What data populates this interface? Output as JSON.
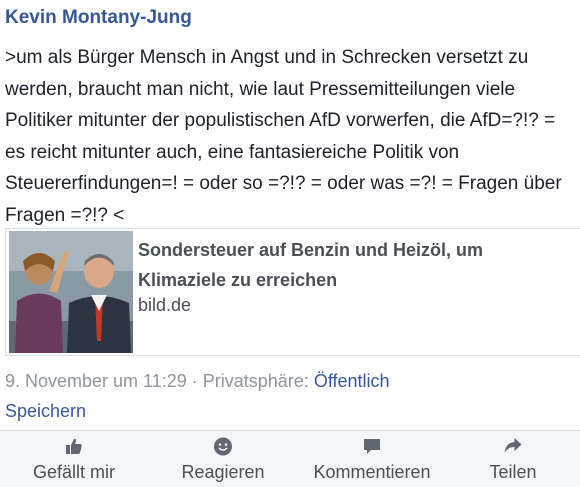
{
  "post": {
    "author": "Kevin Montany-Jung",
    "text": ">um als Bürger Mensch in Angst und in Schrecken versetzt zu werden, braucht man nicht, wie laut Pressemitteilungen viele Politiker mitunter der populistischen AfD vorwerfen, die AfD=?!? = es reicht mitunter auch, eine fantasiereiche Politik von Steuererfindungen=! = oder so =?!? = oder was =?! = Fragen über Fragen =?!? <",
    "link": {
      "title": "Sondersteuer auf Benzin und Heizöl, um Klimaziele zu erreichen",
      "domain": "bild.de",
      "thumbnail_icon": "news-photo-thumbnail"
    },
    "timestamp": "9. November um 11:29",
    "separator": " · ",
    "privacy_label": "Privatsphäre: ",
    "privacy_value": "Öffentlich",
    "save_label": "Speichern"
  },
  "actions": [
    {
      "label": "Gefällt mir",
      "icon": "thumbs-up-icon"
    },
    {
      "label": "Reagieren",
      "icon": "smiley-icon"
    },
    {
      "label": "Kommentieren",
      "icon": "comment-icon"
    },
    {
      "label": "Teilen",
      "icon": "share-icon"
    }
  ],
  "colors": {
    "link_blue": "#365899",
    "meta_gray": "#90949c",
    "text": "#1d2129",
    "action_bar_bg": "#f5f6f7"
  }
}
